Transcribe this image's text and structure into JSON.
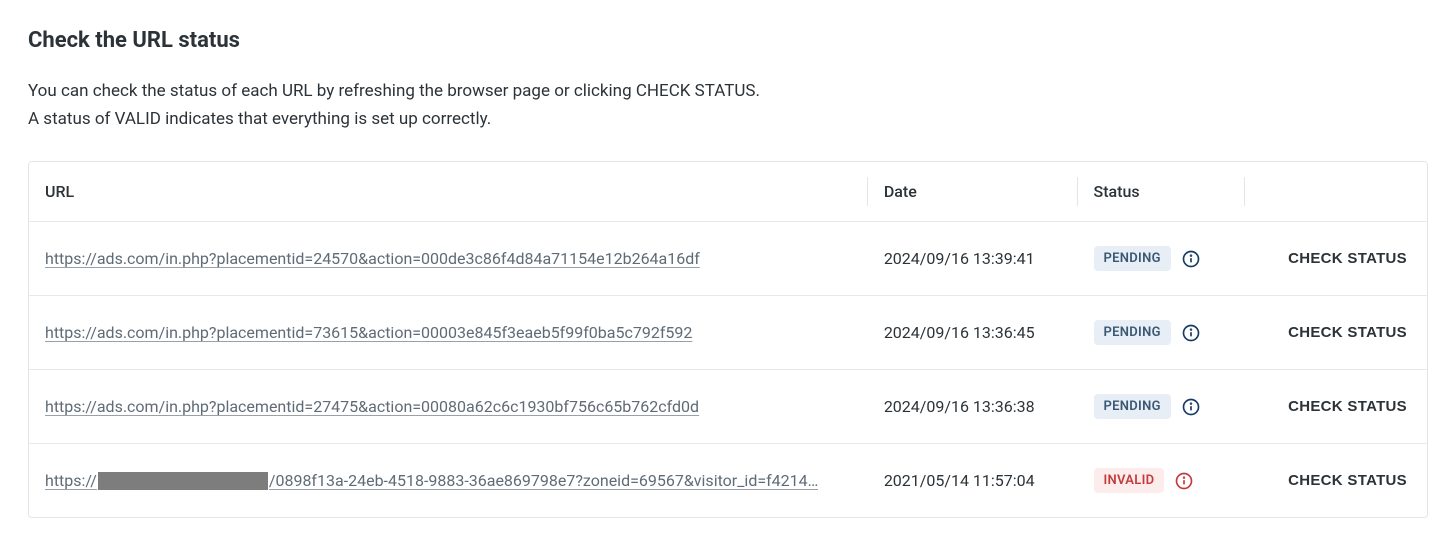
{
  "heading": "Check the URL status",
  "description_line1": "You can check the status of each URL by refreshing the browser page or clicking CHECK STATUS.",
  "description_line2": "A status of VALID indicates that everything is set up correctly.",
  "table": {
    "headers": {
      "url": "URL",
      "date": "Date",
      "status": "Status",
      "action": ""
    },
    "rows": [
      {
        "url_prefix": "https://ads.com/in.php?placementid=24570&action=000de3c86f4d84a71154e12b264a16df",
        "redacted": false,
        "url_suffix": "",
        "date": "2024/09/16 13:39:41",
        "status": "PENDING",
        "status_type": "pending",
        "action": "CHECK STATUS"
      },
      {
        "url_prefix": "https://ads.com/in.php?placementid=73615&action=00003e845f3eaeb5f99f0ba5c792f592",
        "redacted": false,
        "url_suffix": "",
        "date": "2024/09/16 13:36:45",
        "status": "PENDING",
        "status_type": "pending",
        "action": "CHECK STATUS"
      },
      {
        "url_prefix": "https://ads.com/in.php?placementid=27475&action=00080a62c6c1930bf756c65b762cfd0d",
        "redacted": false,
        "url_suffix": "",
        "date": "2024/09/16 13:36:38",
        "status": "PENDING",
        "status_type": "pending",
        "action": "CHECK STATUS"
      },
      {
        "url_prefix": "https://",
        "redacted": true,
        "url_suffix": "/0898f13a-24eb-4518-9883-36ae869798e7?zoneid=69567&visitor_id=f4214…",
        "date": "2021/05/14 11:57:04",
        "status": "INVALID",
        "status_type": "invalid",
        "action": "CHECK STATUS"
      }
    ]
  }
}
